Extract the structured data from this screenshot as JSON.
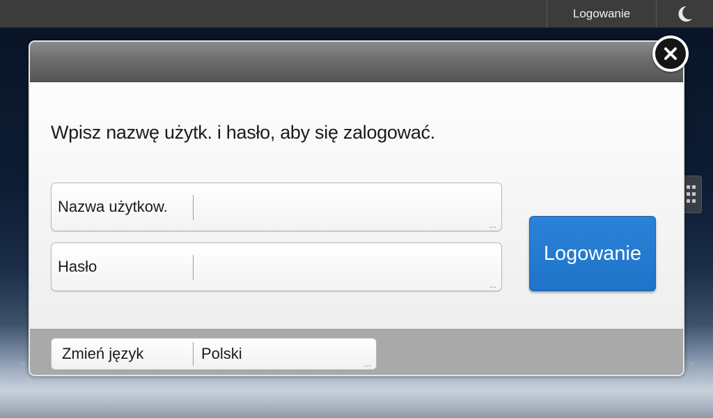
{
  "topbar": {
    "login_label": "Logowanie",
    "moon_icon": "moon-icon"
  },
  "dialog": {
    "prompt": "Wpisz nazwę użytk. i hasło, aby się zalogować.",
    "username": {
      "label": "Nazwa użytkow.",
      "value": ""
    },
    "password": {
      "label": "Hasło",
      "value": ""
    },
    "login_button": "Logowanie",
    "language": {
      "label": "Zmień język",
      "value": "Polski"
    },
    "ellipsis": "..."
  },
  "colors": {
    "accent": "#1f73c8",
    "topbar": "#3c3c3c",
    "footer": "#a9a9a9"
  }
}
